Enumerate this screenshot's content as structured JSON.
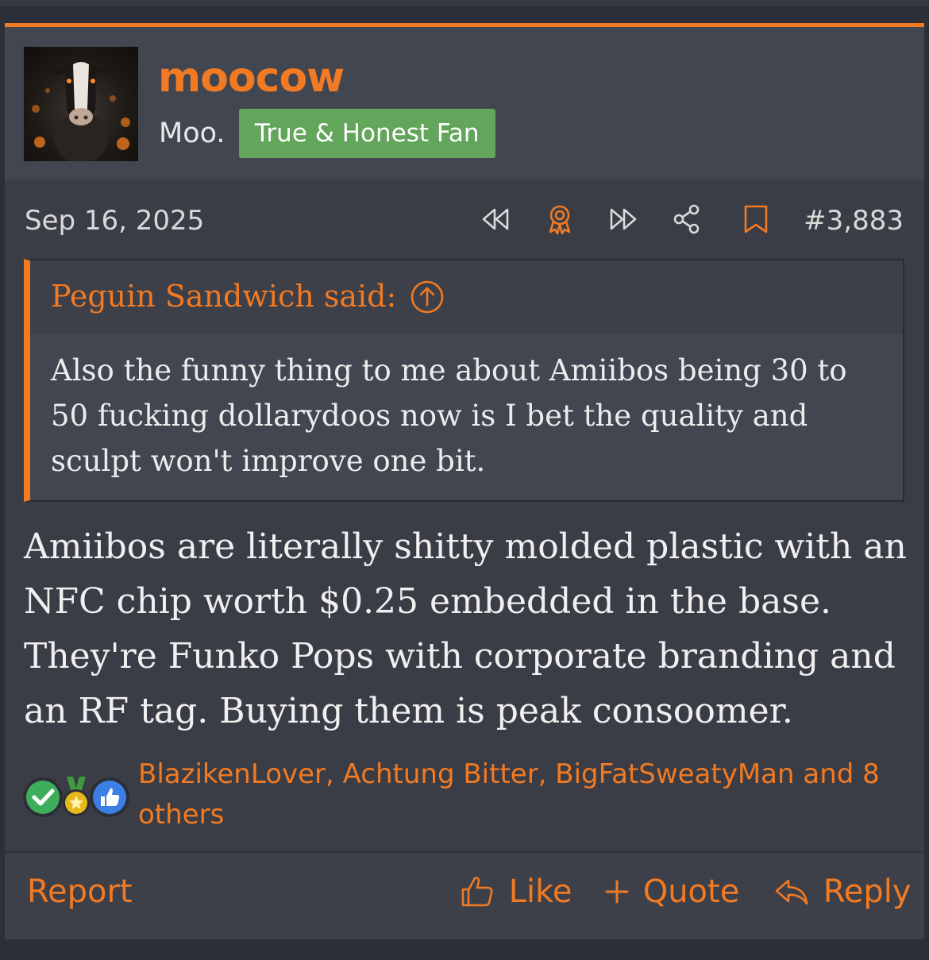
{
  "post": {
    "username": "moocow",
    "user_title": "Moo.",
    "user_banner": "True & Honest Fan",
    "date": "Sep 16, 2025",
    "post_number": "#3,883",
    "actions": [
      {
        "name": "first-unread-icon",
        "label": "rewind"
      },
      {
        "name": "award-icon",
        "label": "award"
      },
      {
        "name": "next-icon",
        "label": "forward"
      },
      {
        "name": "share-icon",
        "label": "share"
      },
      {
        "name": "bookmark-icon",
        "label": "bookmark"
      }
    ]
  },
  "quote": {
    "author_label": "Peguin Sandwich said:",
    "text": "Also the funny thing to me about Amiibos being 30 to 50 fucking dollarydoos now is I bet the quality and sculpt won't improve one bit."
  },
  "message": {
    "text": "Amiibos are literally shitty molded plastic with an NFC chip worth $0.25 embedded in the base. They're Funko Pops with corporate branding and an RF tag. Buying them is peak consoomer."
  },
  "reactions": {
    "icons": [
      "checkmark-reaction-icon",
      "medal-reaction-icon",
      "thumbs-up-reaction-icon"
    ],
    "summary": "BlazikenLover, Achtung Bitter, BigFatSweatyMan and 8 others"
  },
  "footer": {
    "report_label": "Report",
    "like_label": "Like",
    "quote_label": "Quote",
    "reply_label": "Reply"
  },
  "colors": {
    "accent": "#f27a22",
    "banner": "#62a55b",
    "panel": "#3a3d46",
    "header": "#424650"
  }
}
